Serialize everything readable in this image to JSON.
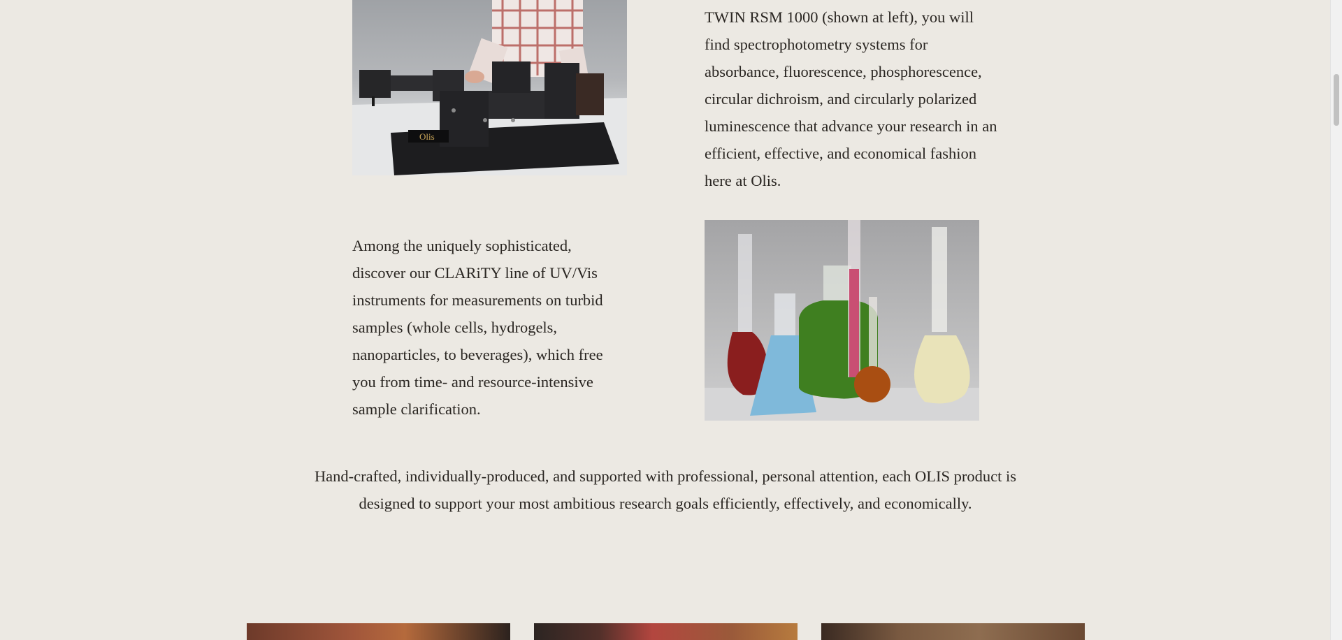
{
  "content": {
    "right_paragraph": "TWIN RSM 1000 (shown at left), you will find spectrophotometry systems for absorbance, fluorescence, phosphorescence, circular dichroism, and circularly polarized luminescence that advance your research in an efficient, effective, and economical fashion here at Olis.",
    "left_paragraph": "Among the uniquely sophisticated, discover our CLARiTY line of UV/Vis instruments for measurements on turbid samples (whole cells, hydrogels, nanoparticles, to beverages), which free you from time- and resource-intensive sample clarification.",
    "closing_paragraph": "Hand-crafted, individually-produced, and supported with professional, personal attention, each OLIS product is designed to support your most ambitious research goals efficiently, effectively, and economically."
  },
  "images": {
    "instrument_logo": "Olis"
  },
  "colors": {
    "page_background": "#ece9e3",
    "text": "#2a2622"
  }
}
